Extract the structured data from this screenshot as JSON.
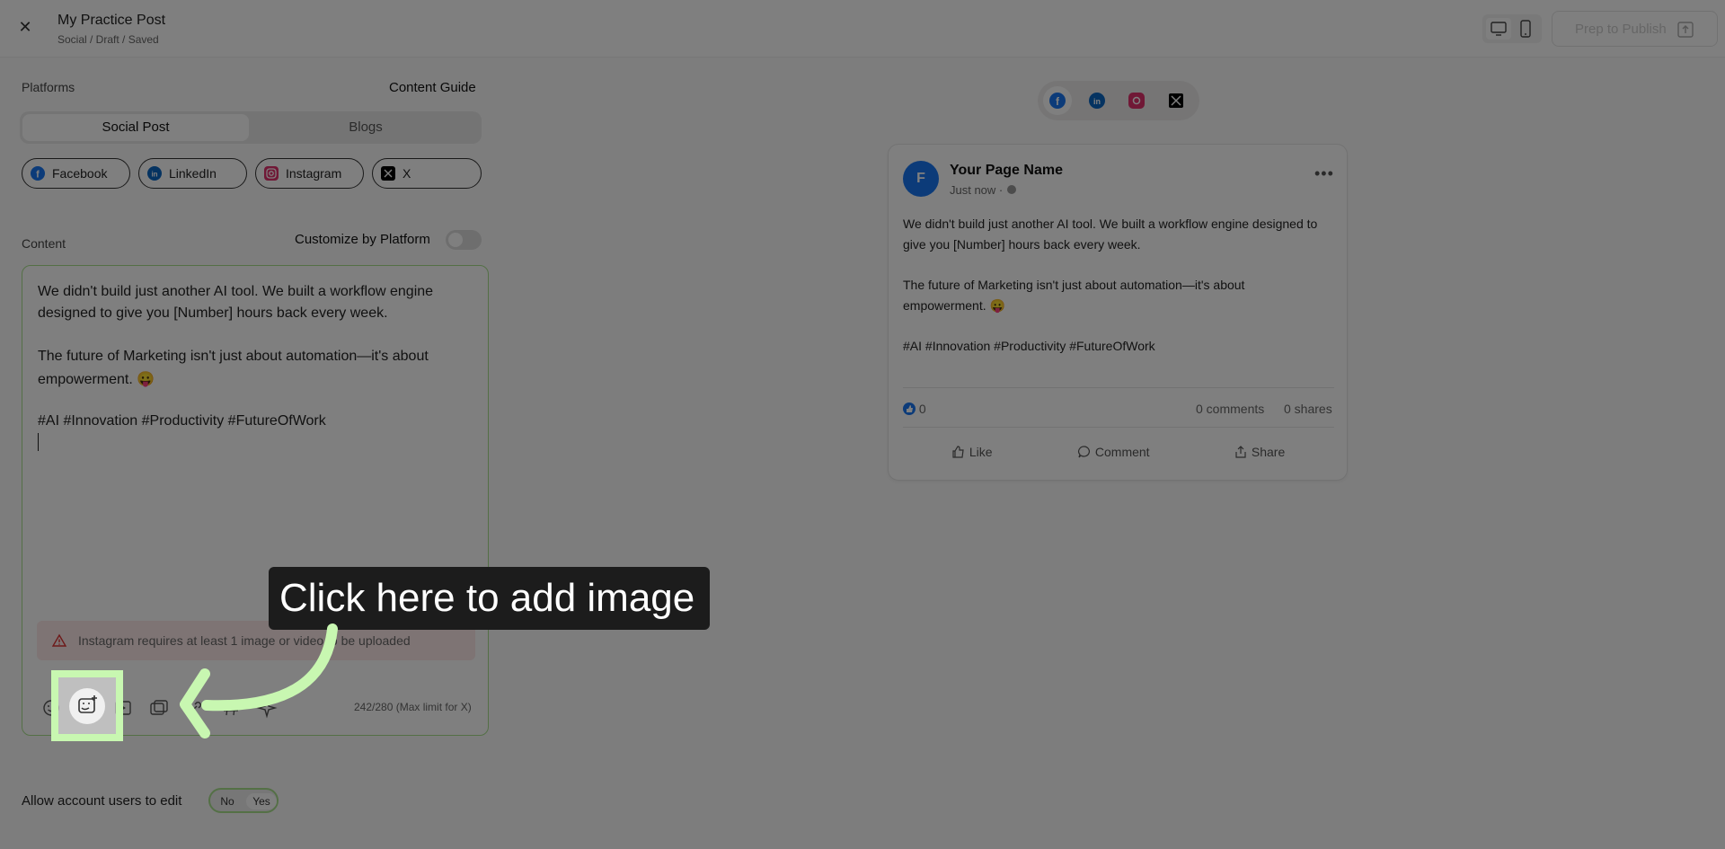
{
  "header": {
    "title": "My Practice Post",
    "breadcrumb": "Social / Draft / Saved",
    "prep_button": "Prep to Publish"
  },
  "left": {
    "platforms_label": "Platforms",
    "content_guide": "Content Guide",
    "tabs": [
      "Social Post",
      "Blogs"
    ],
    "active_tab": "Social Post",
    "chips": [
      {
        "label": "Facebook",
        "color": "#1877f2"
      },
      {
        "label": "LinkedIn",
        "color": "#0a66c2"
      },
      {
        "label": "Instagram",
        "color": "#e1306c"
      },
      {
        "label": "X",
        "color": "#000000"
      }
    ],
    "content_label": "Content",
    "customize_label": "Customize by Platform",
    "customize_on": false,
    "editor_lines": [
      "We didn't build just another AI tool. We built a workflow engine",
      "designed to give you [Number] hours back every week.",
      "The future of Marketing isn't just about automation—it's about",
      "empowerment. 😛",
      "#AI #Innovation #Productivity #FutureOfWork"
    ],
    "warning": "Instagram requires at least 1 image or video to be uploaded",
    "counter": "242/280 (Max limit for X)",
    "allow_label": "Allow account users to edit",
    "allow_no": "No",
    "allow_yes": "Yes",
    "allow_value": "Yes"
  },
  "preview": {
    "page_name": "Your Page Name",
    "avatar_letter": "F",
    "timestamp": "Just now ·",
    "post_lines": [
      "We didn't build just another AI tool. We built a workflow engine designed to",
      "give you [Number] hours back every week.",
      "The future of Marketing isn't just about automation—it's about",
      "empowerment. 😛",
      "#AI #Innovation #Productivity #FutureOfWork"
    ],
    "likes": "0",
    "comments": "0 comments",
    "shares": "0 shares",
    "actions": [
      "Like",
      "Comment",
      "Share"
    ]
  },
  "tour": {
    "callout": "Click here to add image",
    "highlight_color": "#c8f7b1"
  }
}
